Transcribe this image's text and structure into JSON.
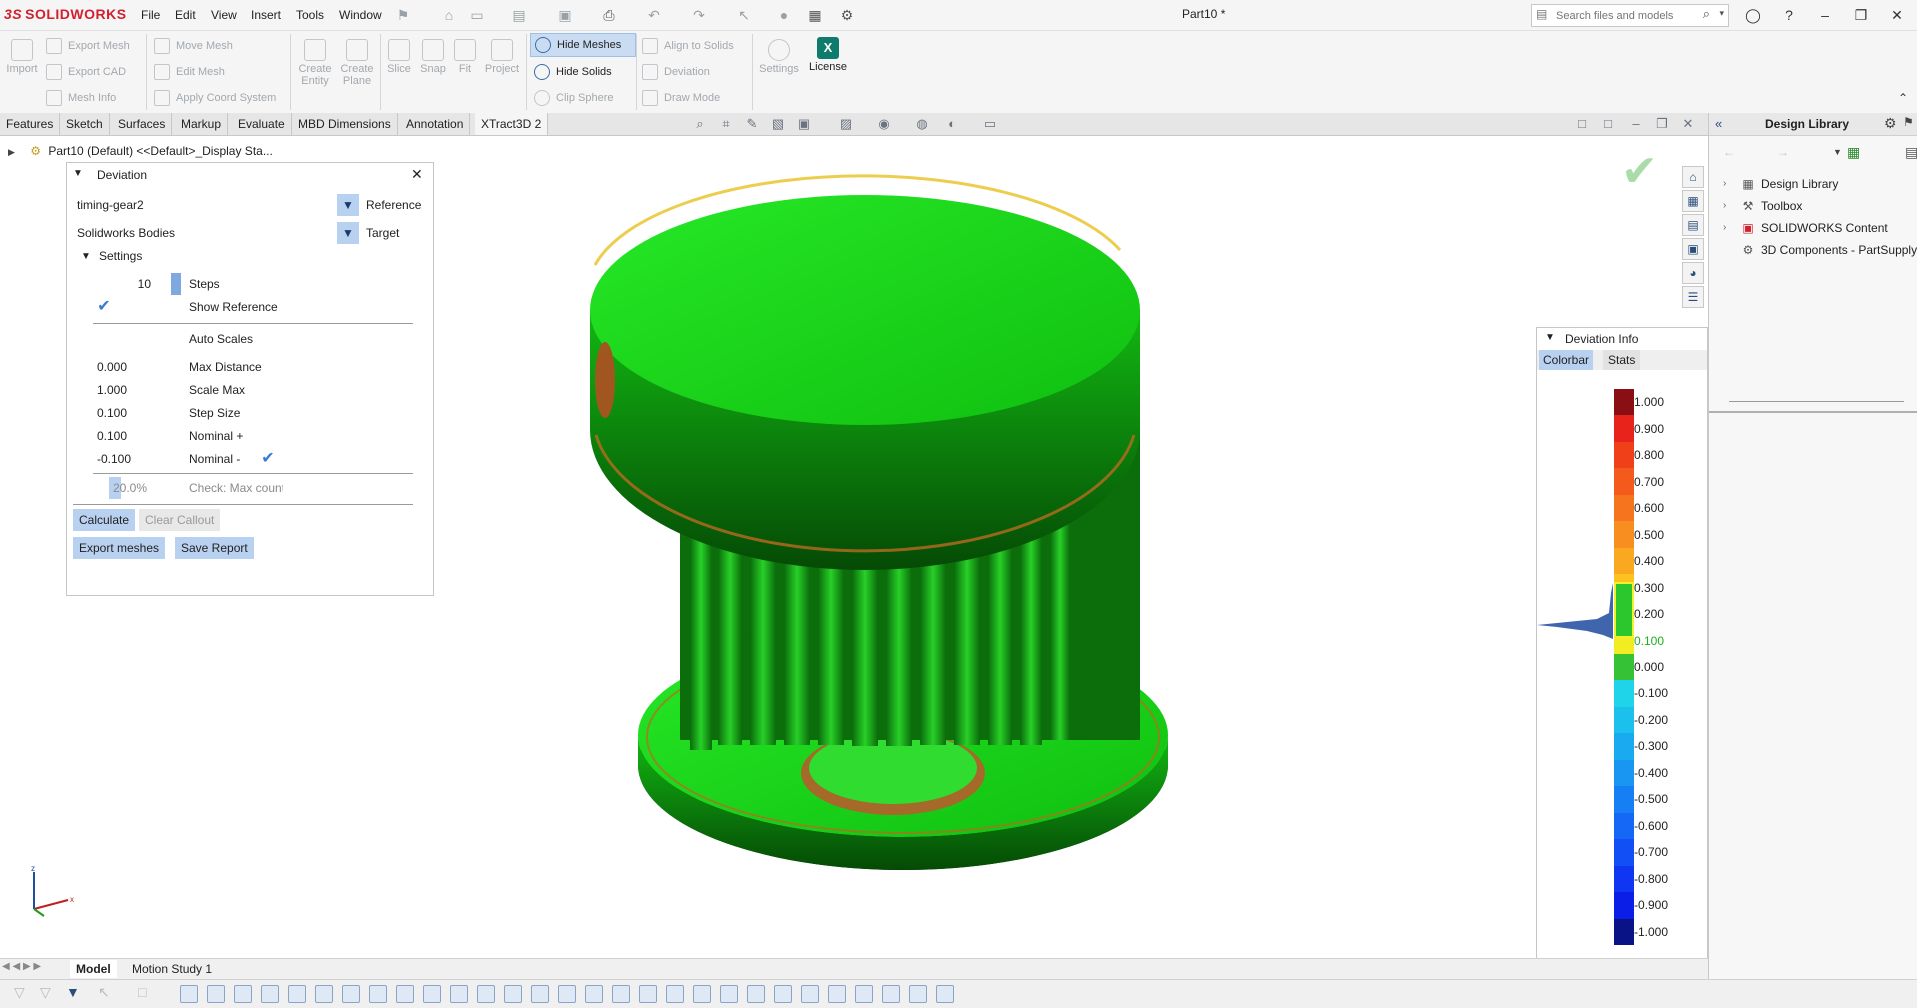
{
  "app": {
    "brand": "SOLIDWORKS",
    "brand_prefix": "3S",
    "document_title": "Part10 *",
    "menu": [
      "File",
      "Edit",
      "View",
      "Insert",
      "Tools",
      "Window"
    ],
    "search_placeholder": "Search files and models"
  },
  "toolbar": {
    "import": "Import",
    "export_mesh": "Export Mesh",
    "export_cad": "Export CAD",
    "mesh_info": "Mesh Info",
    "move_mesh": "Move Mesh",
    "edit_mesh": "Edit Mesh",
    "apply_coord_system": "Apply Coord System",
    "create_entity": "Create Entity",
    "create_plane": "Create Plane",
    "slice": "Slice",
    "snap": "Snap",
    "fit": "Fit",
    "project": "Project",
    "hide_meshes": "Hide Meshes",
    "hide_solids": "Hide Solids",
    "clip_sphere": "Clip Sphere",
    "align_to_solids": "Align to Solids",
    "deviation": "Deviation",
    "draw_mode": "Draw Mode",
    "settings": "Settings",
    "license": "License"
  },
  "tabs": [
    "Features",
    "Sketch",
    "Surfaces",
    "Markup",
    "Evaluate",
    "MBD Dimensions",
    "Annotation",
    "XTract3D 2"
  ],
  "tree": {
    "root": "Part10 (Default) <<Default>_Display Sta..."
  },
  "deviation_panel": {
    "title": "Deviation",
    "reference_value": "timing-gear2",
    "reference_label": "Reference",
    "target_value": "Solidworks Bodies",
    "target_label": "Target",
    "settings_label": "Settings",
    "steps_value": "10",
    "steps_label": "Steps",
    "show_reference_label": "Show Reference",
    "auto_scales_label": "Auto Scales",
    "max_distance_value": "0.000",
    "max_distance_label": "Max Distance",
    "scale_max_value": "1.000",
    "scale_max_label": "Scale Max",
    "step_size_value": "0.100",
    "step_size_label": "Step Size",
    "nominal_plus_value": "0.100",
    "nominal_plus_label": "Nominal +",
    "nominal_minus_value": "-0.100",
    "nominal_minus_label": "Nominal -",
    "max_count_value": "20.0%",
    "max_count_fraction": 0.2,
    "max_count_label": "Check: Max count",
    "calculate": "Calculate",
    "clear_callout": "Clear Callout",
    "export_meshes": "Export meshes",
    "save_report": "Save Report"
  },
  "deviation_info": {
    "title": "Deviation Info",
    "tab_colorbar": "Colorbar",
    "tab_stats": "Stats",
    "scale": [
      "1.000",
      "0.900",
      "0.800",
      "0.700",
      "0.600",
      "0.500",
      "0.400",
      "0.300",
      "0.200",
      "0.100",
      "0.000",
      "-0.100",
      "-0.200",
      "-0.300",
      "-0.400",
      "-0.500",
      "-0.600",
      "-0.700",
      "-0.800",
      "-0.900",
      "-1.000"
    ],
    "highlight_color": "#1fae1f"
  },
  "design_library": {
    "title": "Design Library",
    "items": [
      "Design Library",
      "Toolbox",
      "SOLIDWORKS Content",
      "3D Components - PartSupply"
    ]
  },
  "bottom_tabs": [
    "Model",
    "Motion Study 1"
  ],
  "colors": {
    "model_green": "#1fd11f",
    "accent_blue": "#b9d1f0",
    "brand_red": "#d2202f"
  }
}
